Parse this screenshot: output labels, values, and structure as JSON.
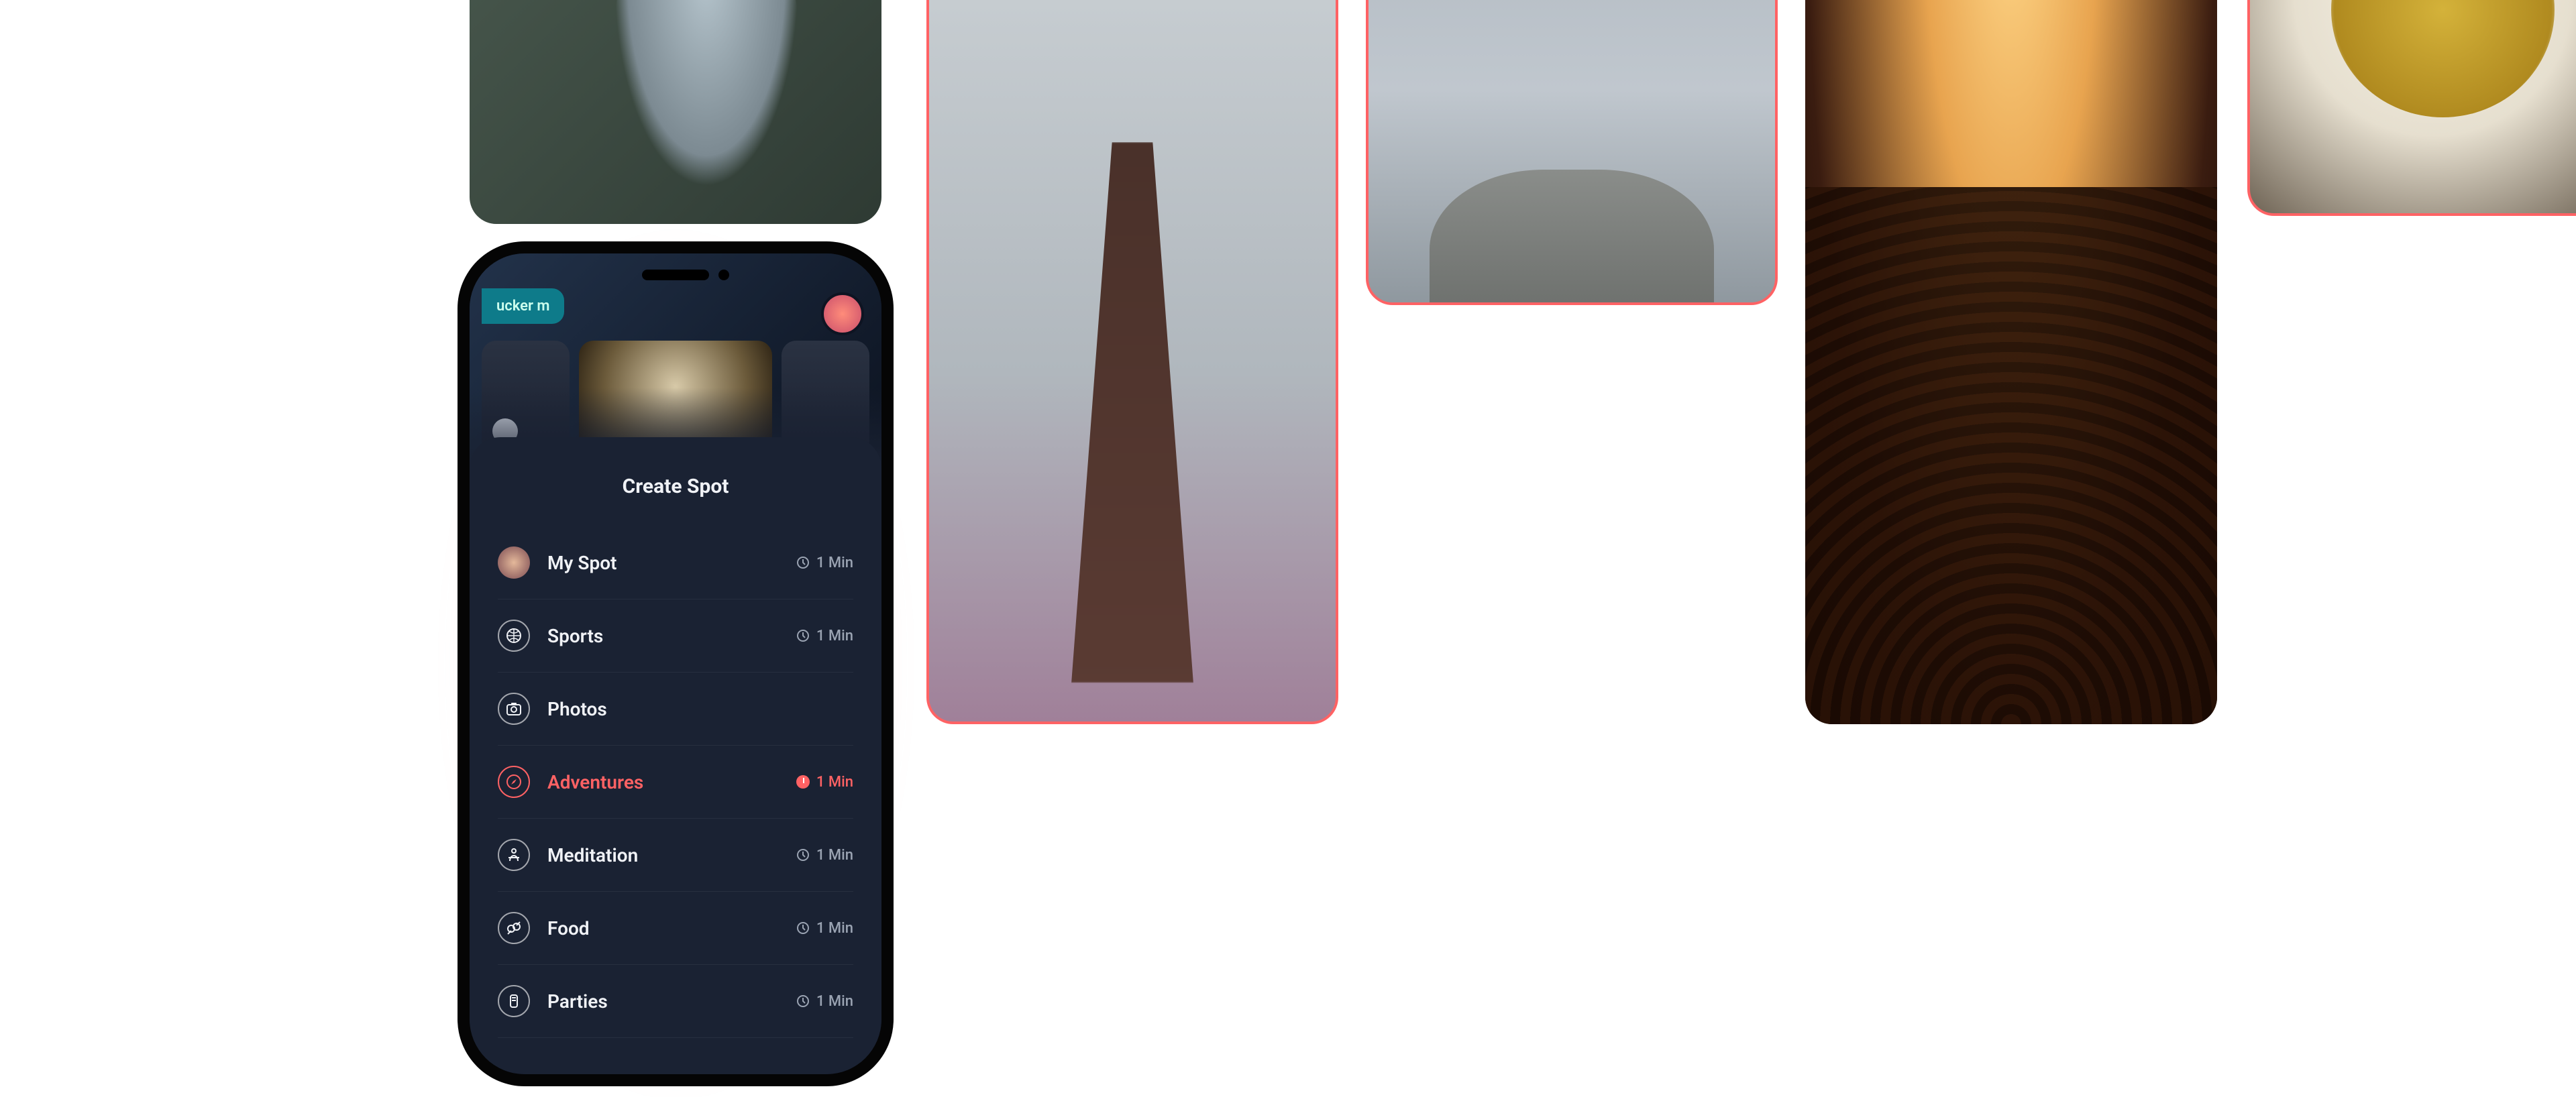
{
  "accent": "#ff6264",
  "gallery": {
    "meditation": {
      "img_desc": "woman meditating outdoors",
      "selected": false
    },
    "girl": {
      "img_desc": "girl with flower crown from behind",
      "selected": true
    },
    "hiker": {
      "img_desc": "hiker on rocky peak",
      "selected": true
    },
    "concert": {
      "img_desc": "concert crowd with stage lights",
      "selected": false
    },
    "food": {
      "img_desc": "plate of yellow rice with spoon",
      "selected": true
    }
  },
  "phone": {
    "top_chip": "ucker m",
    "sheet_title": "Create Spot",
    "categories": [
      {
        "icon": "avatar",
        "label": "My Spot",
        "time": "1 Min",
        "active": false,
        "has_time": true
      },
      {
        "icon": "sports",
        "label": "Sports",
        "time": "1 Min",
        "active": false,
        "has_time": true
      },
      {
        "icon": "camera",
        "label": "Photos",
        "time": "",
        "active": false,
        "has_time": false
      },
      {
        "icon": "compass",
        "label": "Adventures",
        "time": "1 Min",
        "active": true,
        "has_time": true
      },
      {
        "icon": "meditation",
        "label": "Meditation",
        "time": "1 Min",
        "active": false,
        "has_time": true
      },
      {
        "icon": "food",
        "label": "Food",
        "time": "1 Min",
        "active": false,
        "has_time": true
      },
      {
        "icon": "parties",
        "label": "Parties",
        "time": "1 Min",
        "active": false,
        "has_time": true
      }
    ]
  }
}
